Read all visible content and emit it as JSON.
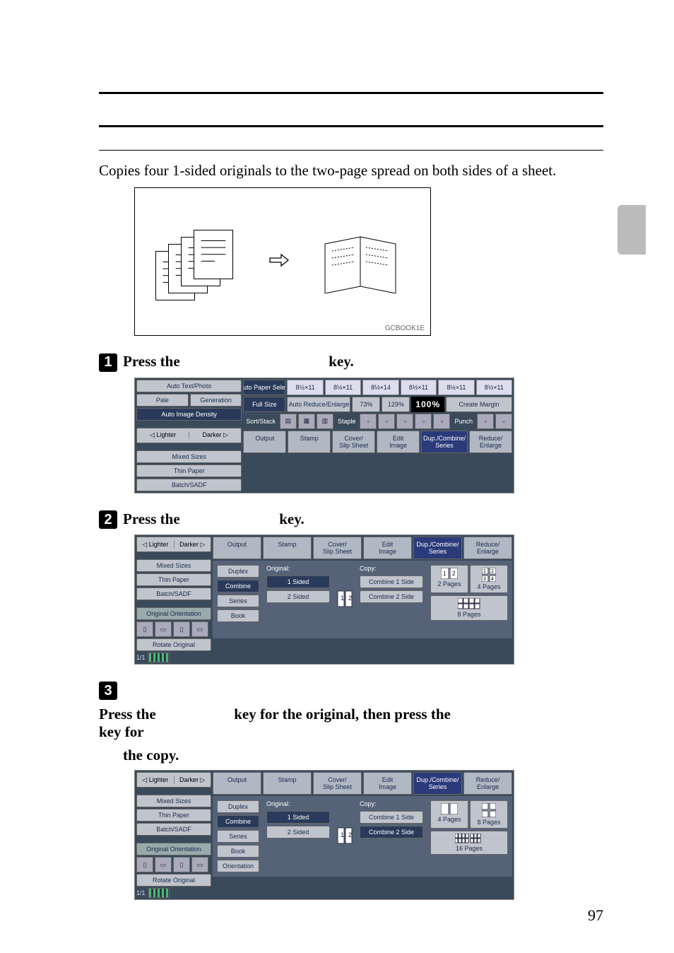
{
  "page": {
    "description": "Copies four 1-sided originals to the two-page spread on both sides of a sheet.",
    "figure_label": "GCBOOK1E",
    "page_number": "97"
  },
  "steps": {
    "s1a": "Press the ",
    "s1b": " key.",
    "s2a": "Press the ",
    "s2b": " key.",
    "s3a": "Press the ",
    "s3b": " key for the original, then press the ",
    "s3c": " key for",
    "s3d": "the copy."
  },
  "copier_ui": {
    "left": {
      "auto_text_photo": "Auto Text/Photo",
      "pale": "Pale",
      "generation": "Generation",
      "auto_image_density": "Auto Image Density",
      "lighter": "◁ Lighter",
      "darker": "Darker ▷",
      "mixed_sizes": "Mixed Sizes",
      "thin_paper": "Thin Paper",
      "batch_sadf": "Batch/SADF",
      "original_orientation": "Original Orientation",
      "rotate_original": "Rotate Original"
    },
    "top": {
      "paper_select": "Auto Paper Select",
      "trays": [
        "8½×11",
        "8½×11",
        "8½×14",
        "8½×11",
        "8½×11",
        "8½×11"
      ],
      "full_size": "Full Size",
      "auto_reduce": "Auto Reduce/Enlarge",
      "r1": "73%",
      "r2": "129%",
      "ratio": "100%",
      "create_margin": "Create Margin",
      "sort_stack": "Sort/Stack",
      "staple": "Staple",
      "punch": "Punch"
    },
    "tabs": {
      "output": "Output",
      "stamp": "Stamp",
      "cover_slip": "Cover/\nSlip Sheet",
      "edit_image": "Edit\nImage",
      "dup_combine": "Dup./Combine/\nSeries",
      "reduce_enlarge": "Reduce/\nEnlarge"
    },
    "panel": {
      "side": {
        "duplex": "Duplex",
        "combine": "Combine",
        "series": "Series",
        "book": "Book",
        "orientation": "Orientation"
      },
      "original_label": "Original:",
      "copy_label": "Copy:",
      "one_sided": "1 Sided",
      "two_sided": "2 Sided",
      "combine_1_side": "Combine 1 Side",
      "combine_2_side": "Combine 2 Side",
      "two_pages": "2 Pages",
      "four_pages": "4 Pages",
      "eight_pages": "8 Pages",
      "sixteen_pages": "16 Pages"
    },
    "status": "1/1"
  }
}
